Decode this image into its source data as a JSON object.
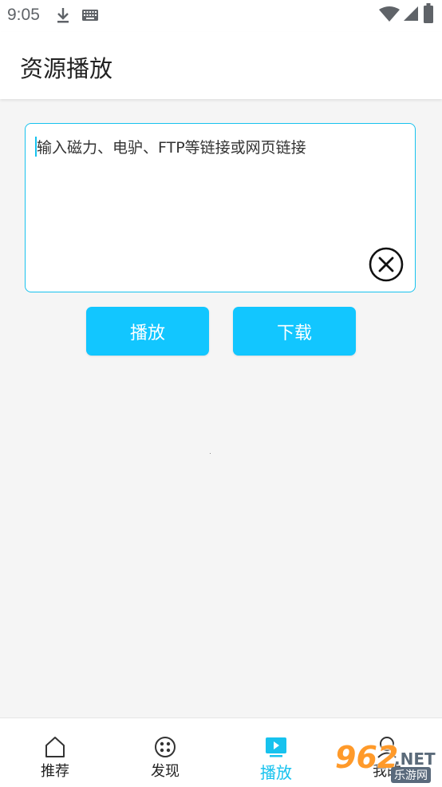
{
  "status_bar": {
    "time": "9:05",
    "icons": [
      "download-icon",
      "keyboard-icon",
      "wifi-icon",
      "signal-icon",
      "battery-icon"
    ]
  },
  "app_bar": {
    "title": "资源播放"
  },
  "url_input": {
    "placeholder": "输入磁力、电驴、FTP等链接或网页链接",
    "value": ""
  },
  "buttons": {
    "play_label": "播放",
    "download_label": "下载"
  },
  "bottom_nav": {
    "items": [
      {
        "label": "推荐",
        "icon": "home-icon",
        "active": false
      },
      {
        "label": "发现",
        "icon": "film-reel-icon",
        "active": false
      },
      {
        "label": "播放",
        "icon": "play-icon",
        "active": true
      },
      {
        "label": "我的",
        "icon": "user-icon",
        "active": false
      }
    ]
  },
  "watermark": {
    "brand_number": "962",
    "brand_suffix": ".NET",
    "brand_sub": "乐游网"
  },
  "colors": {
    "accent": "#12c6ff",
    "border_accent": "#17c2ee",
    "background": "#f5f5f5",
    "watermark_orange": "#ff9a2a"
  }
}
